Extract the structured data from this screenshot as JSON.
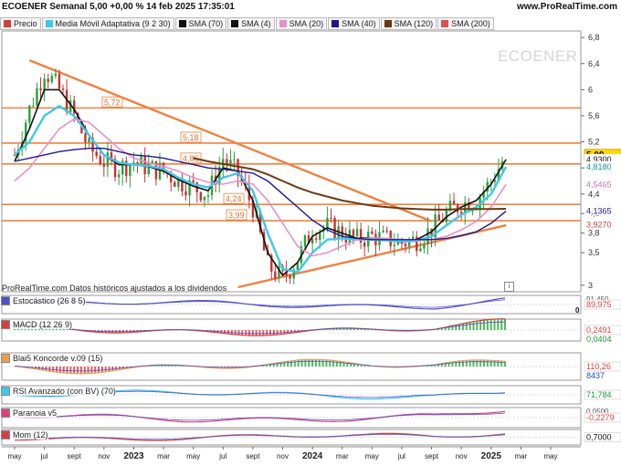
{
  "header": {
    "title": "ECOENER Semanal 5,00 +0,00 % 14 feb 2025 17:35:01",
    "site": "www.ProRealTime.com"
  },
  "legend": [
    {
      "label": "Precio",
      "color": "#d04040"
    },
    {
      "label": "Media Móvil Adaptativa (9 2 30)",
      "color": "#40c8e8"
    },
    {
      "label": "SMA (70)",
      "color": "#111111"
    },
    {
      "label": "SMA (4)",
      "color": "#111111"
    },
    {
      "label": "SMA (20)",
      "color": "#e890c8"
    },
    {
      "label": "SMA (40)",
      "color": "#1a1a90"
    },
    {
      "label": "SMA (120)",
      "color": "#6b3a10"
    },
    {
      "label": "SMA (200)",
      "color": "#e05050"
    }
  ],
  "watermark": "ECOENER",
  "datos_note": "ProRealTime.com Datos históricos ajustados a los dividendos",
  "info_glyph": "i",
  "price_axis": {
    "ticks": [
      "6,8",
      "6,4",
      "6",
      "5,6",
      "5,2",
      "4,8",
      "4,4",
      "4,1",
      "3,8",
      "3,5",
      "3"
    ]
  },
  "right_tags": [
    {
      "text": "5,00",
      "bg": "#ffd800",
      "fg": "#000000",
      "bold": true,
      "price": 5.0
    },
    {
      "text": "4,9300",
      "bg": "#ffffff",
      "fg": "#111111",
      "price": 4.93
    },
    {
      "text": "4,8180",
      "bg": "#ffffff",
      "fg": "#1a8fb0",
      "price": 4.818
    },
    {
      "text": "4,5465",
      "bg": "#ffffff",
      "fg": "#d070b0",
      "price": 4.5465
    },
    {
      "text": "4,1725",
      "bg": "#ffffff",
      "fg": "#6b3a10",
      "price": 4.1725
    },
    {
      "text": "4,1365",
      "bg": "#ffffff",
      "fg": "#1a1a90",
      "price": 4.1365
    },
    {
      "text": "3,9270",
      "bg": "#ffffff",
      "fg": "#d04040",
      "price": 3.927
    }
  ],
  "level_labels": [
    "5,72",
    "5,18",
    "4,86",
    "4,24",
    "3,99"
  ],
  "time_axis": {
    "labels": [
      {
        "t": "may",
        "bold": false
      },
      {
        "t": "jul",
        "bold": false
      },
      {
        "t": "sept",
        "bold": false
      },
      {
        "t": "nov",
        "bold": false
      },
      {
        "t": "2023",
        "bold": true
      },
      {
        "t": "mar",
        "bold": false
      },
      {
        "t": "may",
        "bold": false
      },
      {
        "t": "jul",
        "bold": false
      },
      {
        "t": "sept",
        "bold": false
      },
      {
        "t": "nov",
        "bold": false
      },
      {
        "t": "2024",
        "bold": true
      },
      {
        "t": "mar",
        "bold": false
      },
      {
        "t": "may",
        "bold": false
      },
      {
        "t": "jul",
        "bold": false
      },
      {
        "t": "sept",
        "bold": false
      },
      {
        "t": "nov",
        "bold": false
      },
      {
        "t": "2025",
        "bold": true
      },
      {
        "t": "mar",
        "bold": false
      },
      {
        "t": "may",
        "bold": false
      }
    ]
  },
  "indicators": [
    {
      "label": "Estocástico (26 8 5)",
      "color": "#5050c8",
      "tag": "89,975",
      "tag_color": "#e04040",
      "extra_tag": "0",
      "extra_top": "91,450"
    },
    {
      "label": "MACD (12 26 9)",
      "color": "#d04040",
      "tag": "0,2491",
      "tag_color": "#e04040",
      "tag2": "0,0404",
      "tag2_color": "#1a9a30"
    },
    {
      "label": "Blai5 Koncorde v.09 (15)",
      "color": "#e8a050",
      "tag": "110,26",
      "tag_color": "#d04040",
      "tag2": "8437",
      "tag2_color": "#2050c0"
    },
    {
      "label": "RSI Avanzado (con BV) (70)",
      "color": "#40c8e8",
      "tag": "71,784",
      "tag_color": "#1a9a30"
    },
    {
      "label": "Paranoia v5",
      "color": "#e04080",
      "tag": "-0,2279",
      "tag_color": "#e04040",
      "extra_top": "0,0500"
    },
    {
      "label": "Mom (12)",
      "color": "#d04040",
      "tag": "0,7000",
      "tag_color": "#111111"
    }
  ],
  "chart_data": {
    "type": "candlestick",
    "title": "ECOENER Semanal",
    "price_range": [
      2.9,
      6.9
    ],
    "x_range": [
      "2022-05",
      "2025-05"
    ],
    "last_price": 5.0,
    "horizontal_levels": [
      5.72,
      5.18,
      4.86,
      4.24,
      3.99
    ],
    "trend_lines": [
      {
        "name": "resistencia",
        "from": {
          "x": "2022-06",
          "y": 6.45
        },
        "to": {
          "x": "2024-09",
          "y": 3.98
        }
      },
      {
        "name": "soporte",
        "from": {
          "x": "2023-08",
          "y": 2.97
        },
        "to": {
          "x": "2025-02",
          "y": 3.92
        }
      }
    ],
    "close_series": {
      "x": [
        "2022-05",
        "2022-06",
        "2022-07",
        "2022-08",
        "2022-09",
        "2022-10",
        "2022-11",
        "2022-12",
        "2023-01",
        "2023-02",
        "2023-03",
        "2023-04",
        "2023-05",
        "2023-06",
        "2023-07",
        "2023-08",
        "2023-09",
        "2023-10",
        "2023-11",
        "2023-12",
        "2024-01",
        "2024-02",
        "2024-03",
        "2024-04",
        "2024-05",
        "2024-06",
        "2024-07",
        "2024-08",
        "2024-09",
        "2024-10",
        "2024-11",
        "2024-12",
        "2025-01",
        "2025-02"
      ],
      "values": [
        5.0,
        5.7,
        6.3,
        6.0,
        5.6,
        5.1,
        4.9,
        4.8,
        4.9,
        4.8,
        4.75,
        4.6,
        4.5,
        4.4,
        4.95,
        4.7,
        4.2,
        3.3,
        3.1,
        3.4,
        3.85,
        3.9,
        3.8,
        3.7,
        3.75,
        3.7,
        3.65,
        3.7,
        3.85,
        4.1,
        4.25,
        4.3,
        4.6,
        5.0
      ]
    },
    "ma_series": [
      {
        "name": "SMA (4)",
        "values": [
          4.9,
          5.4,
          6.0,
          6.0,
          5.7,
          5.3,
          5.0,
          4.85,
          4.85,
          4.82,
          4.75,
          4.62,
          4.52,
          4.45,
          4.8,
          4.75,
          4.3,
          3.5,
          3.15,
          3.35,
          3.75,
          3.88,
          3.8,
          3.72,
          3.73,
          3.7,
          3.66,
          3.7,
          3.82,
          4.05,
          4.2,
          4.3,
          4.55,
          4.93
        ]
      },
      {
        "name": "Media Móvil Adaptativa (9 2 30)",
        "values": [
          5.0,
          5.2,
          5.6,
          5.75,
          5.6,
          5.3,
          5.0,
          4.88,
          4.85,
          4.83,
          4.78,
          4.65,
          4.55,
          4.5,
          4.65,
          4.72,
          4.45,
          3.8,
          3.25,
          3.2,
          3.5,
          3.7,
          3.72,
          3.7,
          3.7,
          3.69,
          3.67,
          3.68,
          3.75,
          3.92,
          4.08,
          4.2,
          4.4,
          4.818
        ]
      },
      {
        "name": "SMA (20)",
        "values": [
          4.6,
          4.8,
          5.1,
          5.4,
          5.55,
          5.5,
          5.3,
          5.1,
          4.95,
          4.88,
          4.82,
          4.75,
          4.65,
          4.58,
          4.55,
          4.6,
          4.55,
          4.3,
          3.95,
          3.6,
          3.45,
          3.5,
          3.6,
          3.7,
          3.73,
          3.72,
          3.7,
          3.69,
          3.7,
          3.75,
          3.85,
          3.98,
          4.2,
          4.5465
        ]
      },
      {
        "name": "SMA (40)",
        "values": [
          4.9,
          4.95,
          5.0,
          5.05,
          5.08,
          5.1,
          5.1,
          5.05,
          5.0,
          4.98,
          4.95,
          4.9,
          4.85,
          4.8,
          4.78,
          4.75,
          4.72,
          4.6,
          4.4,
          4.2,
          4.0,
          3.85,
          3.75,
          3.72,
          3.7,
          3.7,
          3.7,
          3.7,
          3.7,
          3.72,
          3.76,
          3.82,
          3.95,
          4.1365
        ]
      },
      {
        "name": "SMA (120)",
        "values": [
          null,
          null,
          null,
          null,
          null,
          null,
          null,
          null,
          null,
          null,
          null,
          null,
          4.95,
          4.9,
          4.86,
          4.82,
          4.78,
          4.7,
          4.6,
          4.5,
          4.42,
          4.36,
          4.3,
          4.26,
          4.22,
          4.2,
          4.18,
          4.17,
          4.16,
          4.16,
          4.17,
          4.17,
          4.17,
          4.1725
        ]
      }
    ]
  }
}
